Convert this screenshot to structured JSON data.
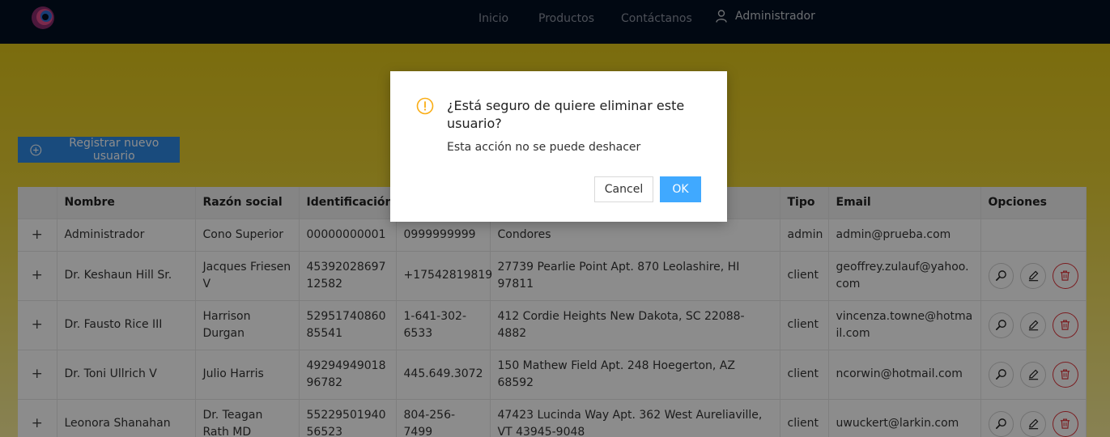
{
  "nav": {
    "logo_icon": "swirl-logo-icon",
    "links": [
      "Inicio",
      "Productos",
      "Contáctanos"
    ],
    "user_label": "Administrador",
    "user_icon": "user-icon"
  },
  "register_button": {
    "label": "Registrar nuevo usuario",
    "icon": "plus-circle-icon"
  },
  "table": {
    "headers": [
      "",
      "Nombre",
      "Razón social",
      "Identificación",
      "",
      "",
      "Tipo",
      "Email",
      "Opciones"
    ],
    "rows": [
      {
        "expand": "+",
        "nombre": "Administrador",
        "razon": "Cono Superior",
        "ident": "00000000001",
        "telefono": "0999999999",
        "direccion": "Condores",
        "tipo": "admin",
        "email": "admin@prueba.com",
        "has_options": false
      },
      {
        "expand": "+",
        "nombre": "Dr. Keshaun Hill Sr.",
        "razon": "Jacques Friesen V",
        "ident": "4539202869712582",
        "telefono": "+17542819819",
        "direccion": "27739 Pearlie Point Apt. 870 Leolashire, HI 97811",
        "tipo": "client",
        "email": "geoffrey.zulauf@yahoo.com",
        "has_options": true
      },
      {
        "expand": "+",
        "nombre": "Dr. Fausto Rice III",
        "razon": "Harrison Durgan",
        "ident": "5295174086085541",
        "telefono": "1-641-302-6533",
        "direccion": "412 Cordie Heights New Dakota, SC 22088-4882",
        "tipo": "client",
        "email": "vincenza.towne@hotmail.com",
        "has_options": true
      },
      {
        "expand": "+",
        "nombre": "Dr. Toni Ullrich V",
        "razon": "Julio Harris",
        "ident": "4929494901896782",
        "telefono": "445.649.3072",
        "direccion": "150 Mathew Field Apt. 248 Hoegerton, AZ 68592",
        "tipo": "client",
        "email": "ncorwin@hotmail.com",
        "has_options": true
      },
      {
        "expand": "+",
        "nombre": "Leonora Shanahan",
        "razon": "Dr. Teagan Rath MD",
        "ident": "5522950194056523",
        "telefono": "804-256-7499",
        "direccion": "47423 Lucinda Way Apt. 362 West Aureliaville, VT 43945-9048",
        "tipo": "client",
        "email": "uwuckert@larkin.com",
        "has_options": true
      }
    ]
  },
  "modal": {
    "title": "¿Está seguro de quiere eliminar este usuario?",
    "content": "Esta acción no se puede deshacer",
    "cancel_label": "Cancel",
    "ok_label": "OK",
    "icon": "exclamation-circle-icon"
  },
  "colors": {
    "nav_bg": "#020f22",
    "accent": "#2f89e3",
    "ok": "#40a9ff",
    "danger": "#e0383e",
    "warning": "#faad14"
  }
}
